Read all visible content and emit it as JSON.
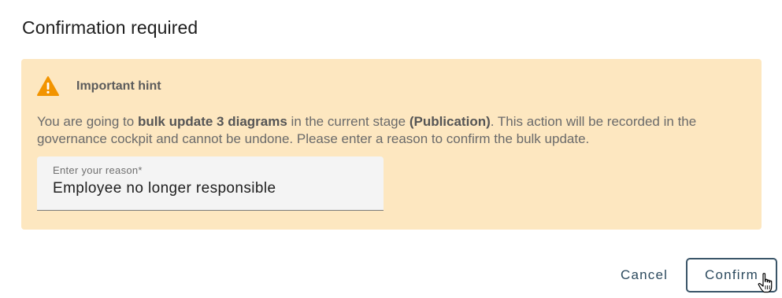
{
  "dialog": {
    "title": "Confirmation required"
  },
  "hint": {
    "icon": "warning-icon",
    "icon_color": "#f29400",
    "background": "#fde7c0",
    "title": "Important hint",
    "text_part1": "You are going to ",
    "text_bold1": "bulk update 3 diagrams",
    "text_part2": " in the current stage ",
    "text_bold2": "(Publication)",
    "text_part3": ". This action will be recorded in the governance cockpit and cannot be undone. Please enter a reason to confirm the bulk update."
  },
  "reason": {
    "label": "Enter your reason*",
    "value": "Employee no longer responsible"
  },
  "actions": {
    "cancel_label": "Cancel",
    "confirm_label": "Confirm",
    "accent_color": "#2c4a5e"
  },
  "cursor": {
    "icon": "hand-pointer-icon"
  }
}
